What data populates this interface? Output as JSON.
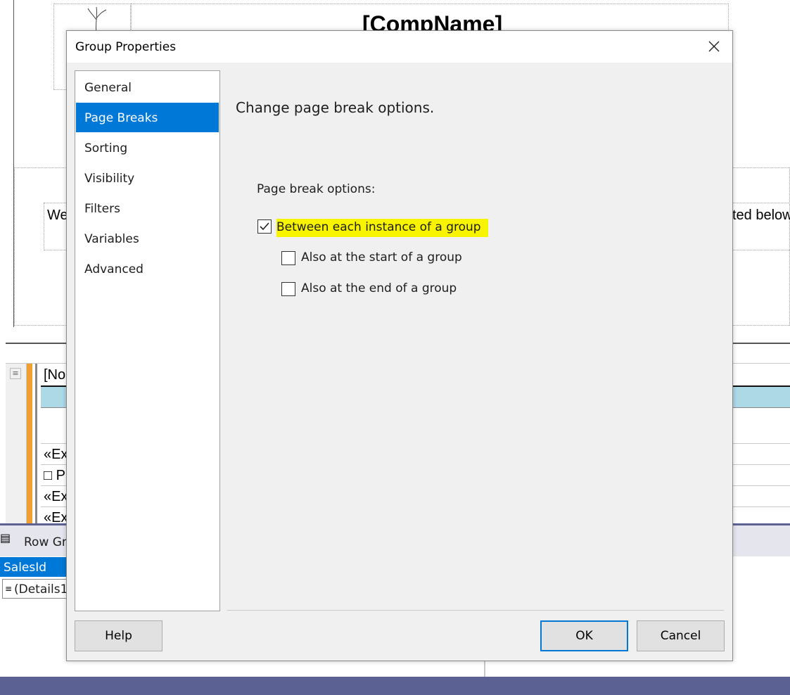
{
  "background": {
    "header_title": "[CompName]",
    "left_text": "We",
    "right_text": "ted below",
    "tablix_header_text": "[No",
    "rows": [
      "«Ex",
      "□ P",
      "«Ex",
      "«Ex"
    ],
    "row_groups_label": "Row Gr",
    "group_selected": "SalesId",
    "group_details": "(Details1)"
  },
  "dialog": {
    "title": "Group Properties",
    "nav": [
      {
        "label": "General",
        "selected": false
      },
      {
        "label": "Page Breaks",
        "selected": true
      },
      {
        "label": "Sorting",
        "selected": false
      },
      {
        "label": "Visibility",
        "selected": false
      },
      {
        "label": "Filters",
        "selected": false
      },
      {
        "label": "Variables",
        "selected": false
      },
      {
        "label": "Advanced",
        "selected": false
      }
    ],
    "heading": "Change page break options.",
    "options_label": "Page break options:",
    "options": [
      {
        "label": "Between each instance of a group",
        "checked": true,
        "highlighted": true
      },
      {
        "label": "Also at the start of a group",
        "checked": false
      },
      {
        "label": "Also at the end of a group",
        "checked": false
      }
    ],
    "buttons": {
      "help": "Help",
      "ok": "OK",
      "cancel": "Cancel"
    }
  },
  "colors": {
    "selection": "#0078d7",
    "highlight": "#f8f400",
    "tablix_header": "#add8e6",
    "accent_orange": "#f0a030"
  }
}
